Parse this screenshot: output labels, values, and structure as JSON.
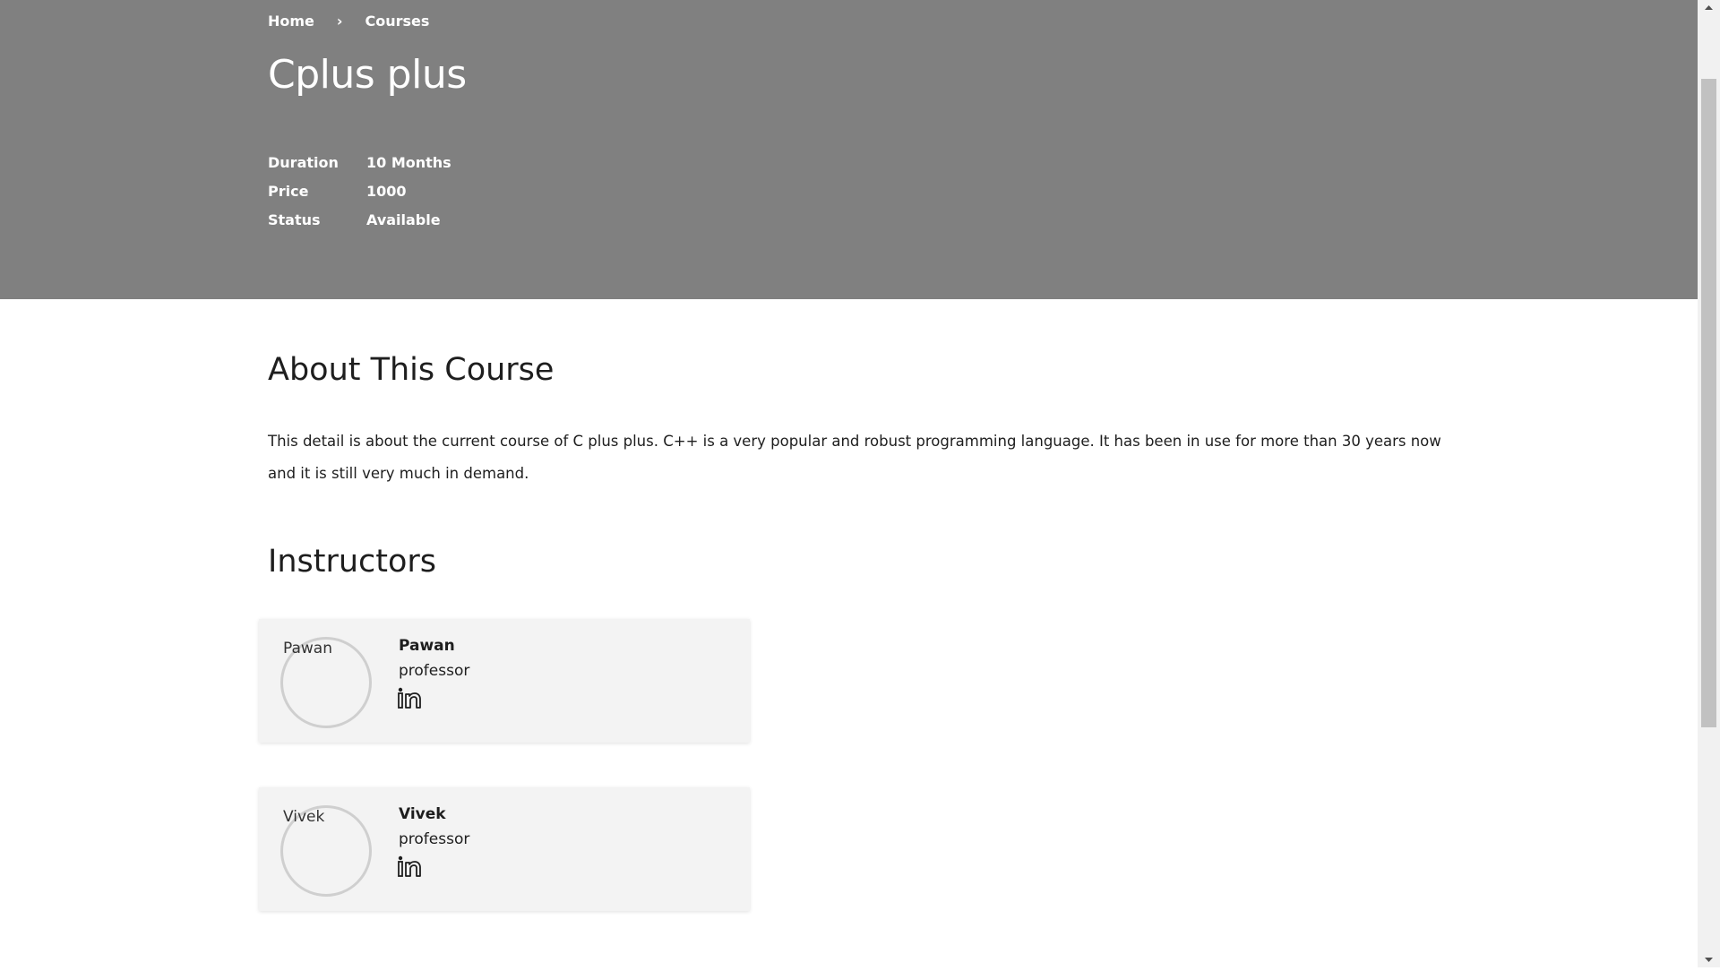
{
  "breadcrumb": {
    "home": "Home",
    "separator": "›",
    "current": "Courses"
  },
  "course": {
    "title": "Cplus plus",
    "meta": [
      {
        "key": "Duration",
        "value": "10 Months"
      },
      {
        "key": "Price",
        "value": "1000"
      },
      {
        "key": "Status",
        "value": "Available"
      }
    ]
  },
  "about": {
    "heading": "About This Course",
    "text": "This detail is about the current course of C plus plus. C++ is a very popular and robust programming language. It has been in use for more than 30 years now and it is still very much in demand."
  },
  "instructors": {
    "heading": "Instructors",
    "list": [
      {
        "name": "Pawan",
        "role": "professor",
        "image_alt": "Pawan",
        "social_icon": "linkedin-icon"
      },
      {
        "name": "Vivek",
        "role": "professor",
        "image_alt": "Vivek",
        "social_icon": "linkedin-icon"
      }
    ]
  },
  "colors": {
    "hero_bg": "#808080",
    "card_bg": "#f3f3f3",
    "text": "#1e1e1e"
  }
}
